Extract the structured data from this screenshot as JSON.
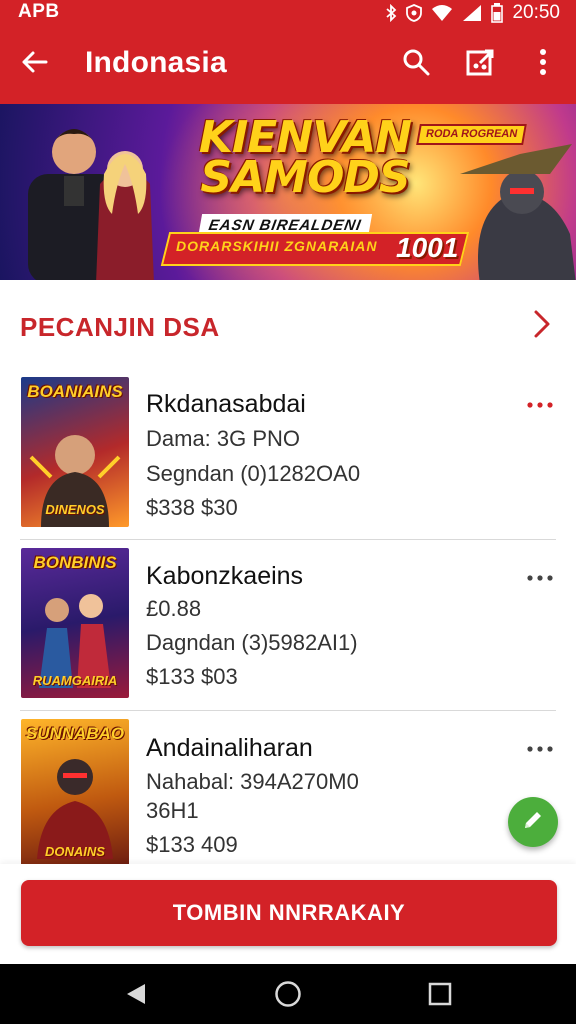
{
  "status_bar": {
    "left_text": "APB",
    "time": "20:50"
  },
  "app_bar": {
    "title": "Indonasia"
  },
  "banner": {
    "title": "KIENVAN SAMODS",
    "subtitle": "EASN BIREALDENI",
    "tag": "RODA ROGREAN",
    "ribbon_text": "DORARSKIHII ZGNARAIAN",
    "ribbon_number": "1001"
  },
  "section": {
    "title": "PECANJIN DSA"
  },
  "items": [
    {
      "name": "Rkdanasabdai",
      "line1": "Dama: 3G PNO",
      "line2": "Segndan (0)1282OA0",
      "line3": "$338 $30",
      "thumb_title": "BOANIAINS",
      "thumb_foot": "DINENOS",
      "more_color": "#d32227"
    },
    {
      "name": "Kabonzkaeins",
      "line1": "£0.88",
      "line2": "Dagndan (3)5982AI1)",
      "line3": "$133 $03",
      "thumb_title": "BONBINIS",
      "thumb_foot": "RUAMGAIRIA",
      "more_color": "#444444"
    },
    {
      "name": "Andainaliharan",
      "line1": "Nahabal: 394A270M0",
      "line2": "36H1",
      "line3": "$133 409",
      "thumb_title": "SUNNABAO",
      "thumb_foot": "DONAINS",
      "more_color": "#444444"
    }
  ],
  "primary_button": {
    "label": "TOMBIN NNRRAKAIY"
  },
  "colors": {
    "brand_red": "#d32227",
    "fab_green": "#4cae3c",
    "section_red": "#c8262b"
  },
  "icons": {
    "back": "arrow-left-icon",
    "search": "search-icon",
    "share": "share-icon",
    "more": "more-vert-icon",
    "chevron": "chevron-right-icon",
    "fab": "edit-icon",
    "nav_back": "nav-back-icon",
    "nav_home": "nav-home-icon",
    "nav_recents": "nav-recents-icon"
  }
}
